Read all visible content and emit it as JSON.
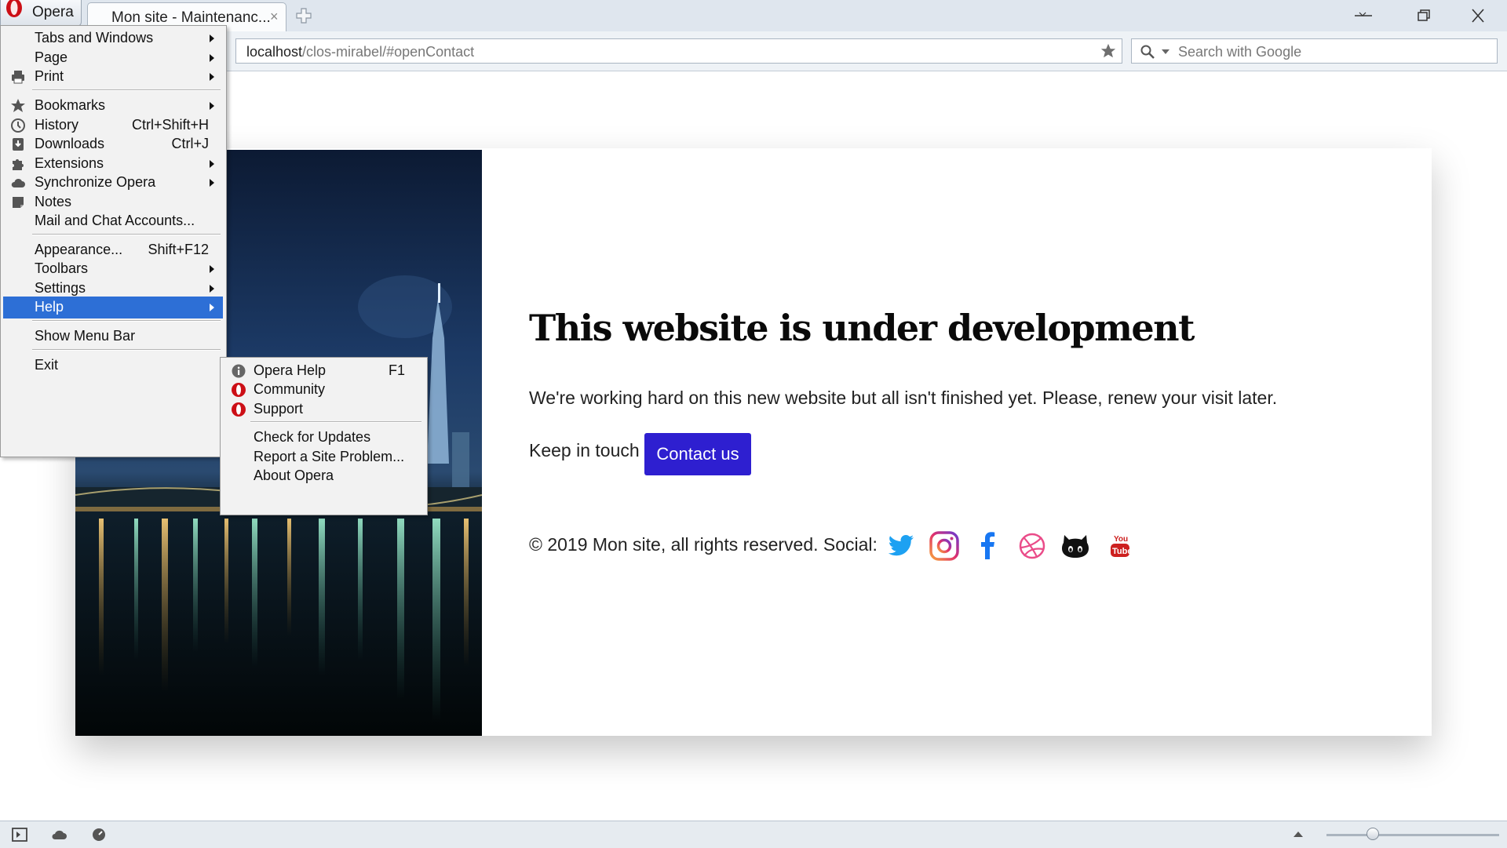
{
  "browser": {
    "opera_button_label": "Opera",
    "tab_title": "Mon site - Maintenanc...",
    "tab_close": "×",
    "address": {
      "host": "localhost",
      "path": "/clos-mirabel/#openContact"
    },
    "search_placeholder": "Search with Google"
  },
  "main_menu": {
    "items": [
      {
        "label": "Tabs and Windows",
        "shortcut": "",
        "submenu": true
      },
      {
        "label": "Page",
        "shortcut": "",
        "submenu": true
      },
      {
        "label": "Print",
        "shortcut": "",
        "submenu": true,
        "icon": "printer-icon"
      },
      {
        "label": "Bookmarks",
        "shortcut": "",
        "submenu": true,
        "icon": "star-icon"
      },
      {
        "label": "History",
        "shortcut": "Ctrl+Shift+H",
        "submenu": false,
        "icon": "clock-icon"
      },
      {
        "label": "Downloads",
        "shortcut": "Ctrl+J",
        "submenu": false,
        "icon": "download-icon"
      },
      {
        "label": "Extensions",
        "shortcut": "",
        "submenu": true,
        "icon": "puzzle-icon"
      },
      {
        "label": "Synchronize Opera",
        "shortcut": "",
        "submenu": true,
        "icon": "cloud-icon"
      },
      {
        "label": "Notes",
        "shortcut": "",
        "submenu": false,
        "icon": "note-icon"
      },
      {
        "label": "Mail and Chat Accounts...",
        "shortcut": "",
        "submenu": false
      },
      {
        "label": "Appearance...",
        "shortcut": "Shift+F12",
        "submenu": false
      },
      {
        "label": "Toolbars",
        "shortcut": "",
        "submenu": true
      },
      {
        "label": "Settings",
        "shortcut": "",
        "submenu": true
      },
      {
        "label": "Help",
        "shortcut": "",
        "submenu": true,
        "active": true
      },
      {
        "label": "Show Menu Bar",
        "shortcut": "",
        "submenu": false
      },
      {
        "label": "Exit",
        "shortcut": "",
        "submenu": false
      }
    ]
  },
  "help_menu": {
    "items": [
      {
        "label": "Opera Help",
        "shortcut": "F1",
        "icon": "info-icon"
      },
      {
        "label": "Community",
        "shortcut": "",
        "icon": "opera-o-icon"
      },
      {
        "label": "Support",
        "shortcut": "",
        "icon": "opera-o-icon"
      },
      {
        "label": "Check for Updates",
        "shortcut": ""
      },
      {
        "label": "Report a Site Problem...",
        "shortcut": ""
      },
      {
        "label": "About Opera",
        "shortcut": ""
      }
    ]
  },
  "page": {
    "title": "This website is under development",
    "text": "We're working hard on this new website but all isn't finished yet. Please, renew your visit later.",
    "keep_in_touch": "Keep in touch",
    "contact_button": "Contact us",
    "footer": "© 2019 Mon site, all rights reserved. Social:",
    "social_icons": [
      "twitter-icon",
      "instagram-icon",
      "facebook-icon",
      "dribbble-icon",
      "github-icon",
      "youtube-icon"
    ]
  },
  "colors": {
    "contact_button": "#2e1fd0",
    "menu_highlight": "#2d6fd6",
    "opera_red": "#cc0f16",
    "twitter": "#1da1f2",
    "instagram": "#c13584",
    "facebook": "#1877f2",
    "dribbble": "#ea4c89",
    "youtube": "#cd201f"
  }
}
